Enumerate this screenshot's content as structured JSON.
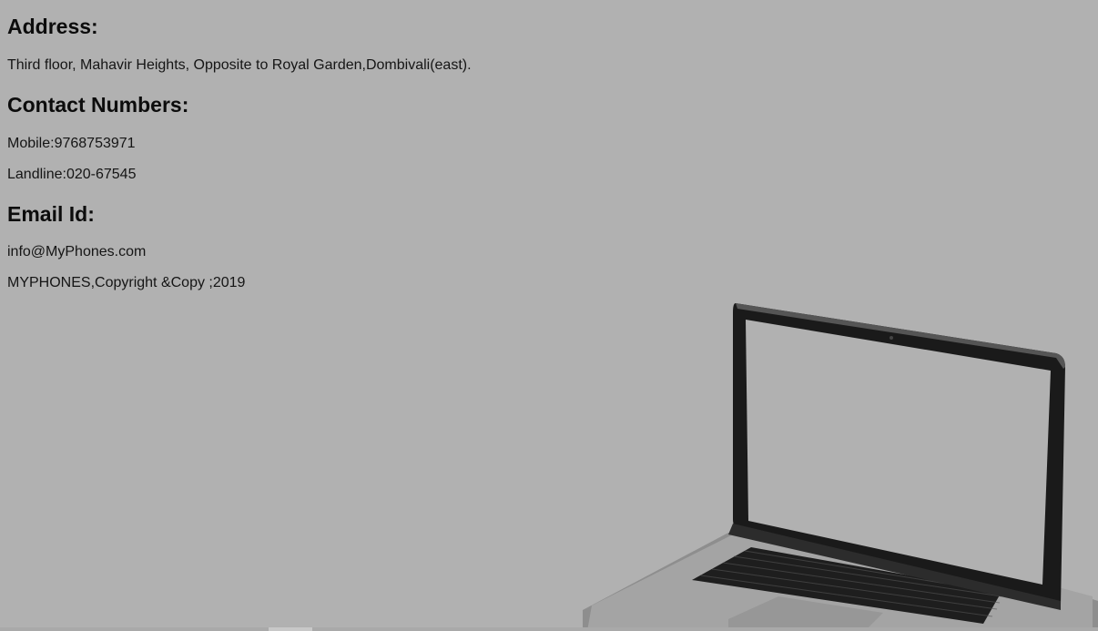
{
  "address": {
    "heading": "Address:",
    "text": "Third floor, Mahavir Heights, Opposite to Royal Garden,Dombivali(east)."
  },
  "contact": {
    "heading": "Contact Numbers:",
    "mobile": "Mobile:9768753971",
    "landline": "Landline:020-67545"
  },
  "email": {
    "heading": "Email Id:",
    "address": "info@MyPhones.com"
  },
  "footer": {
    "copyright": "MYPHONES,Copyright &Copy ;2019"
  },
  "colors": {
    "background": "#b1b1b1",
    "text": "#111111"
  },
  "icons": {
    "laptop": "laptop-image"
  }
}
